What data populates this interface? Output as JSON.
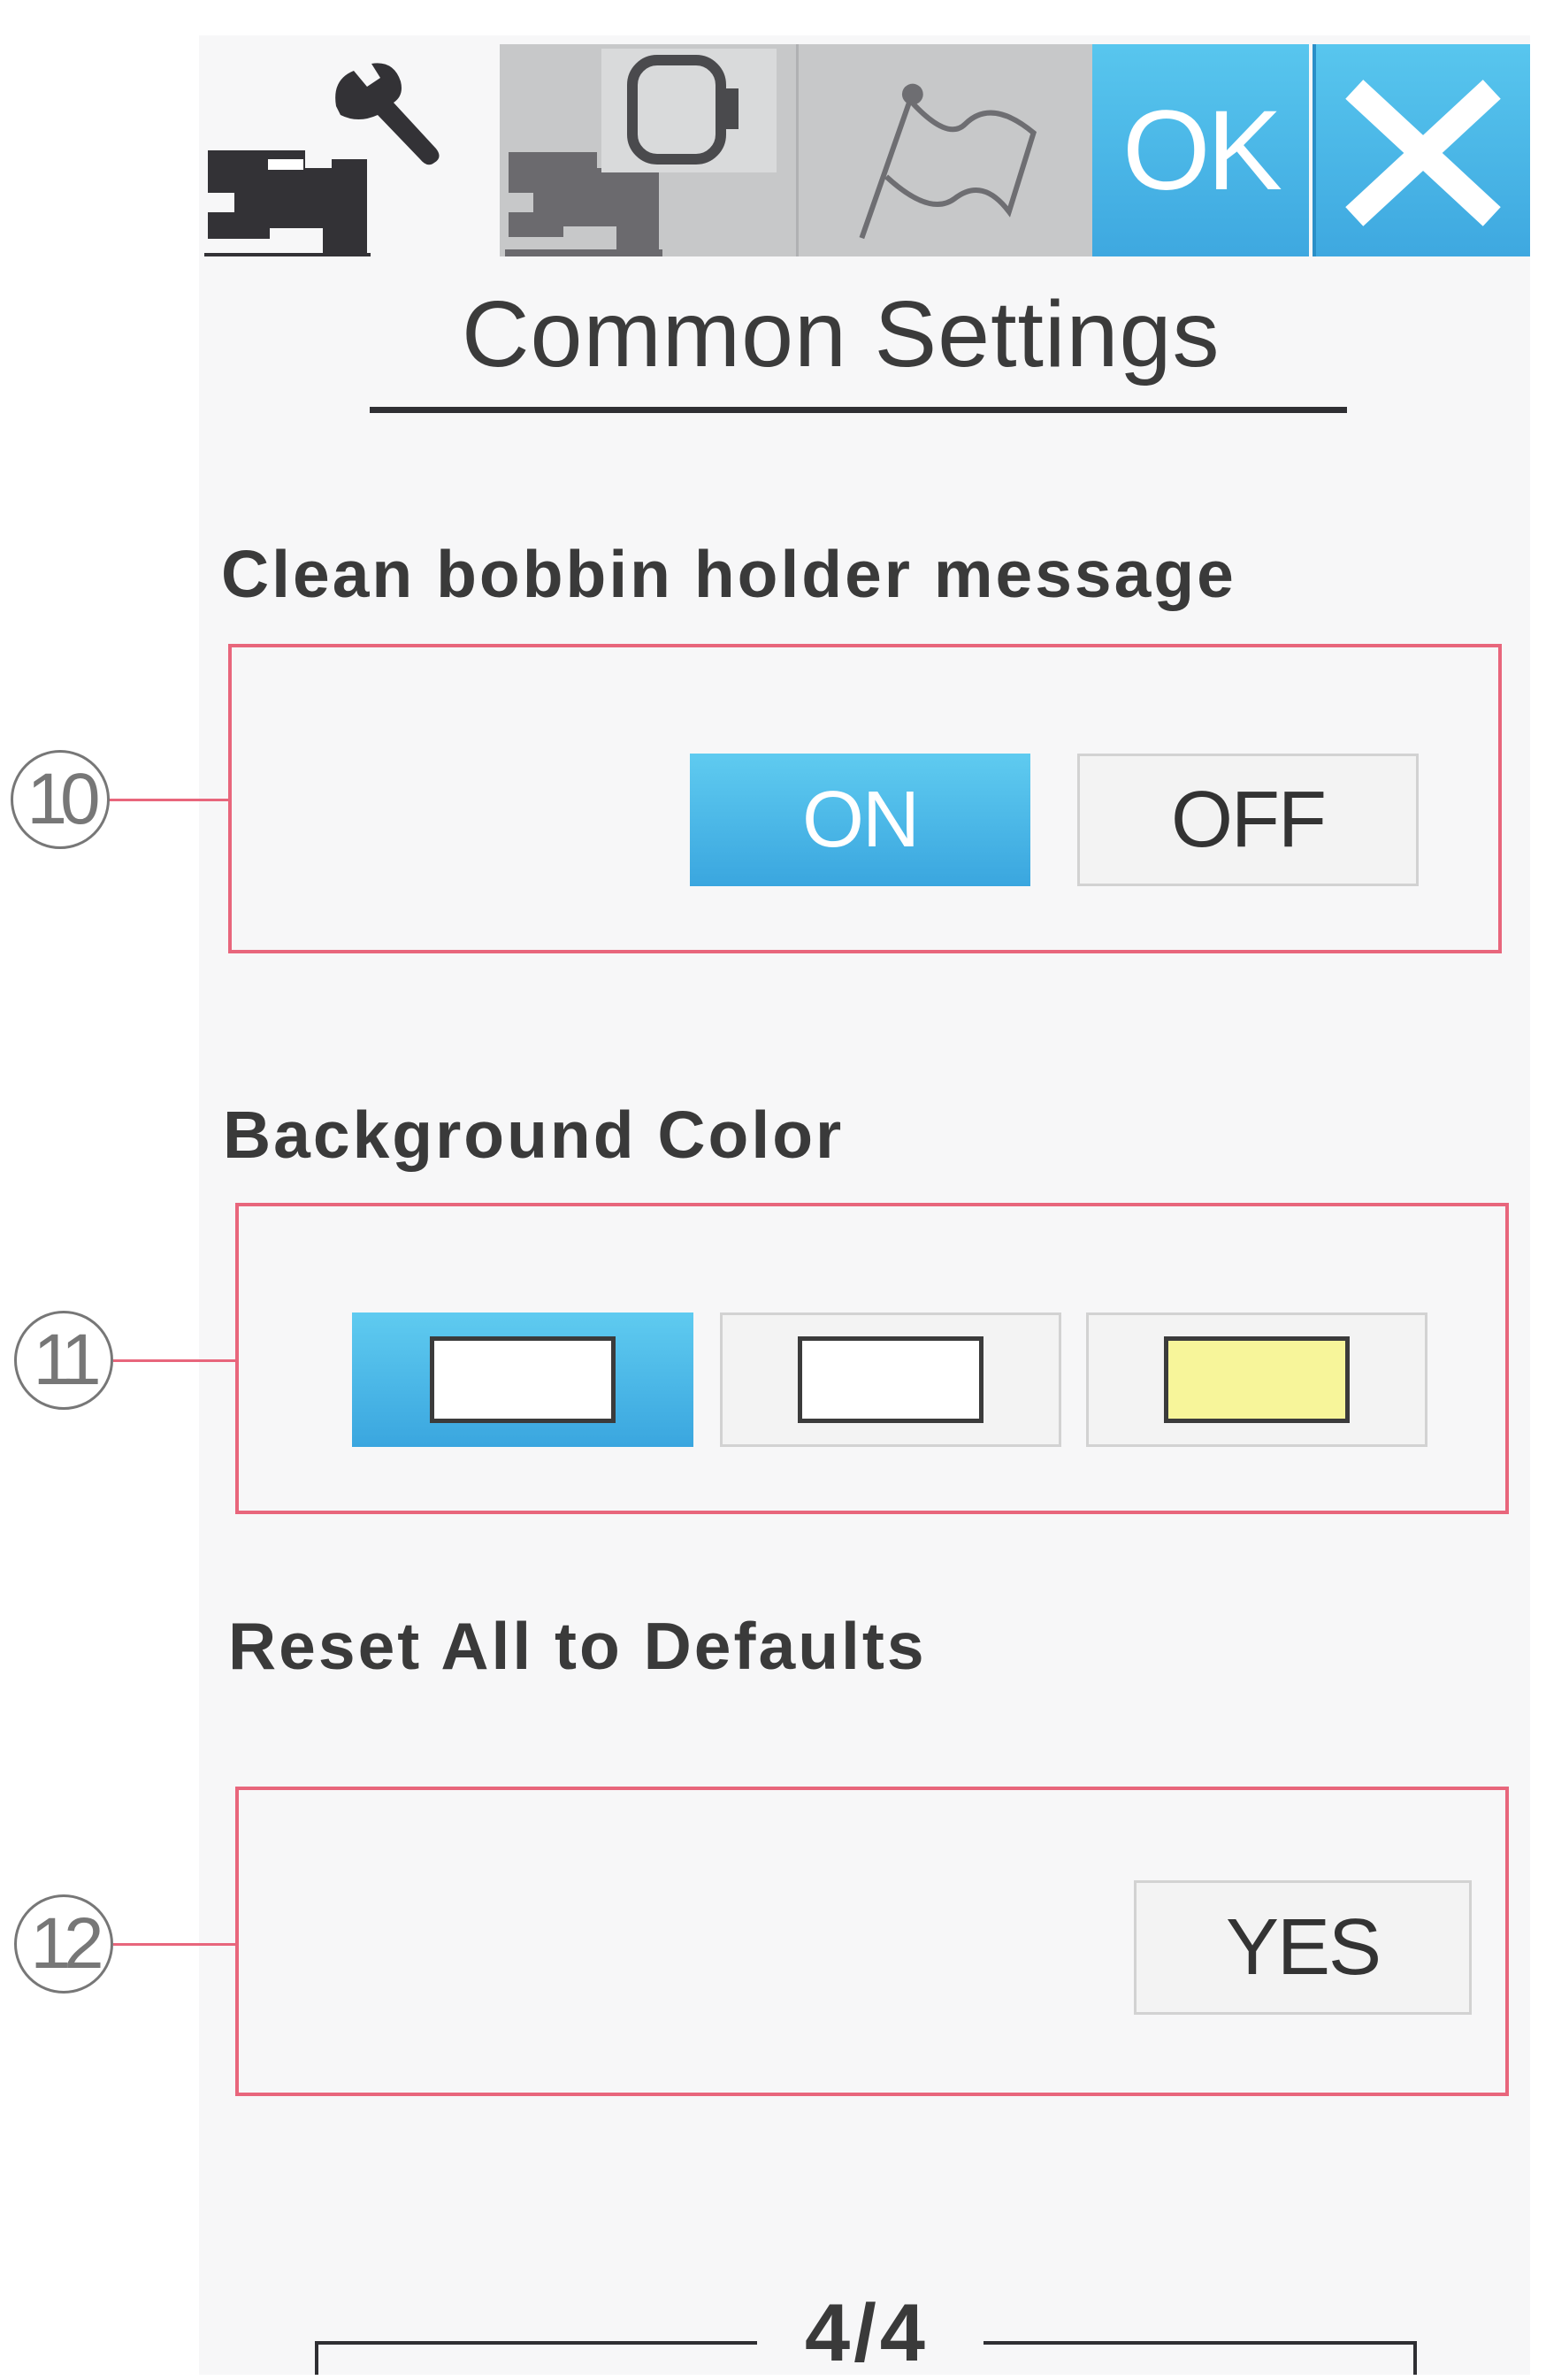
{
  "toolbar": {
    "tabs": [
      {
        "name": "common-settings",
        "icon": "machine-wrench-icon",
        "active": true
      },
      {
        "name": "machine-settings",
        "icon": "machine-hoop-icon",
        "active": false
      },
      {
        "name": "language-settings",
        "icon": "flag-icon",
        "active": false
      }
    ],
    "ok_label": "OK",
    "close_icon": "close-icon"
  },
  "page": {
    "title": "Common Settings",
    "indicator": "4/4"
  },
  "sections": [
    {
      "callout": "10",
      "label": "Clean bobbin holder message",
      "options": [
        "ON",
        "OFF"
      ],
      "selected": "ON"
    },
    {
      "callout": "11",
      "label": "Background Color",
      "swatches": [
        "#ffffff",
        "#ffffff",
        "#f7f59a"
      ],
      "selected_index": 0
    },
    {
      "callout": "12",
      "label": "Reset All to Defaults",
      "button": "YES"
    }
  ],
  "colors": {
    "accent": "#3ea8e0",
    "callout": "#e8667c",
    "inactive_tab": "#c7c8c9",
    "swatch_yellow": "#f7f59a"
  }
}
